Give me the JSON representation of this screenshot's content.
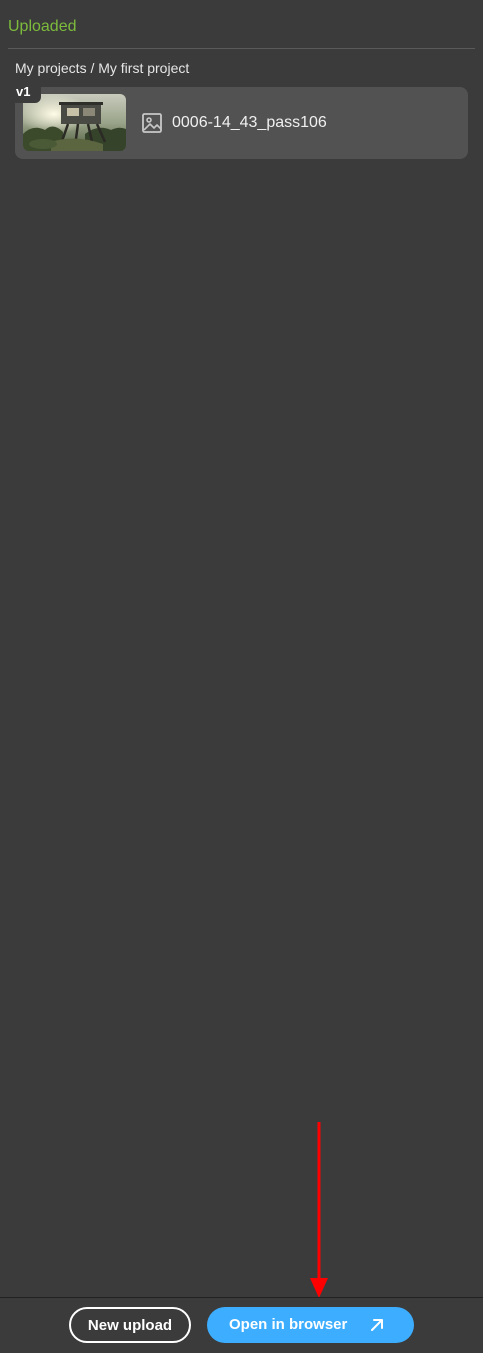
{
  "header": {
    "status": "Uploaded"
  },
  "breadcrumb": {
    "text": "My projects / My first project"
  },
  "file": {
    "version": "v1",
    "name": "0006-14_43_pass106",
    "thumbnail_icon": "house-render-thumbnail",
    "type_icon": "image-icon"
  },
  "footer": {
    "new_upload_label": "New upload",
    "open_browser_label": "Open in browser",
    "open_icon": "arrow-up-right-icon"
  },
  "colors": {
    "background": "#3b3b3b",
    "status_green": "#7dbb3c",
    "card": "#525252",
    "primary_button": "#3daeff",
    "annotation": "#ff0000"
  }
}
